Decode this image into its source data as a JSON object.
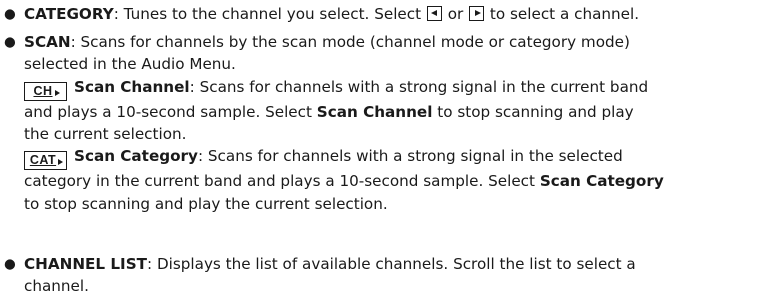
{
  "bullets": [
    {
      "term": "CATEGORY",
      "text_before": ": Tunes to the channel you select. Select ",
      "left_icon": "left-triangle-button-icon",
      "connector": " or ",
      "right_icon": "right-triangle-button-icon",
      "text_after": " to select a channel."
    },
    {
      "term": "SCAN",
      "intro_line1": ": Scans for channels by the scan mode (channel mode or category mode)",
      "intro_line2": "selected in the Audio Menu.",
      "sub_items": [
        {
          "icon_label": "CH",
          "icon_name": "channel-key-icon",
          "term": "Scan Channel",
          "line1": ": Scans for channels with a strong signal in the current band",
          "line2_before": "and plays a 10-second sample. Select ",
          "line2_bold": "Scan Channel",
          "line2_after": " to stop scanning and play",
          "line3": "the current selection."
        },
        {
          "icon_label": "CAT",
          "icon_name": "category-key-icon",
          "term": "Scan Category",
          "line1": ": Scans for channels with a strong signal in the selected",
          "line2_before": "category in the current band and plays a 10-second sample. Select ",
          "line2_bold": "Scan Category",
          "line3": "to stop scanning and play the current selection."
        }
      ]
    },
    {
      "term": "CHANNEL LIST",
      "line1": ": Displays the list of available channels. Scroll the list to select a",
      "line2": "channel."
    }
  ],
  "bullet_symbol": "●"
}
